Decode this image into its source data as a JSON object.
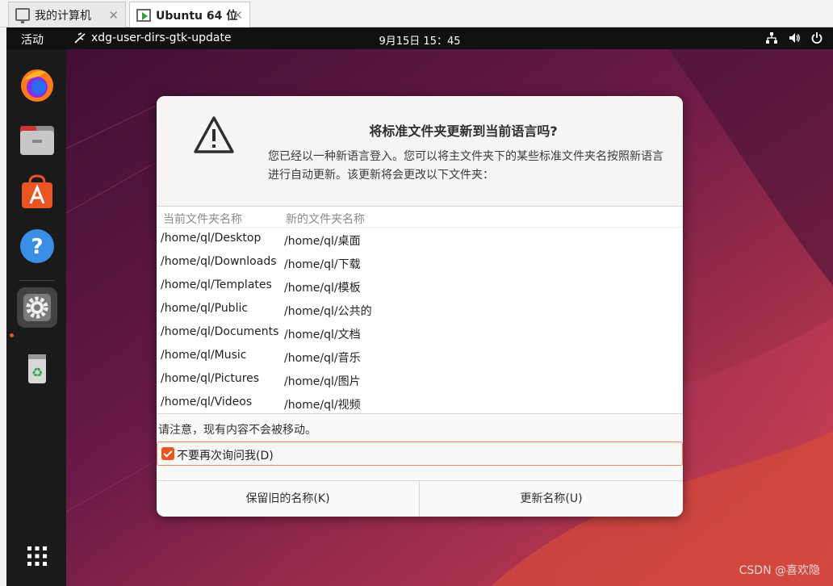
{
  "host_tabs": [
    {
      "label": "我的计算机",
      "icon": "monitor-icon"
    },
    {
      "label": "Ubuntu 64 位",
      "icon": "vm-icon"
    }
  ],
  "topbar": {
    "activities": "活动",
    "app_name": "xdg-user-dirs-gtk-update",
    "clock": "9月15日  15：45"
  },
  "dock": [
    "firefox-icon",
    "files-icon",
    "software-icon",
    "help-icon",
    "settings-icon",
    "trash-icon",
    "app-grid-icon"
  ],
  "dialog": {
    "title": "将标准文件夹更新到当前语言吗?",
    "message": "您已经以一种新语言登入。您可以将主文件夹下的某些标准文件夹名按照新语言进行自动更新。该更新将会更改以下文件夹：",
    "columns": [
      "当前文件夹名称",
      "新的文件夹名称"
    ],
    "rows": [
      [
        "/home/ql/Desktop",
        "/home/ql/桌面"
      ],
      [
        "/home/ql/Downloads",
        "/home/ql/下载"
      ],
      [
        "/home/ql/Templates",
        "/home/ql/模板"
      ],
      [
        "/home/ql/Public",
        "/home/ql/公共的"
      ],
      [
        "/home/ql/Documents",
        "/home/ql/文档"
      ],
      [
        "/home/ql/Music",
        "/home/ql/音乐"
      ],
      [
        "/home/ql/Pictures",
        "/home/ql/图片"
      ],
      [
        "/home/ql/Videos",
        "/home/ql/视频"
      ]
    ],
    "note": "请注意，现有内容不会被移动。",
    "checkbox_label": "不要再次询问我(D)",
    "checkbox_checked": true,
    "keep_button": "保留旧的名称(K)",
    "update_button": "更新名称(U)"
  },
  "watermark": "CSDN @喜欢隐",
  "colors": {
    "accent": "#e95420",
    "topbar": "#111111",
    "dialog_bg": "#fafafa"
  }
}
